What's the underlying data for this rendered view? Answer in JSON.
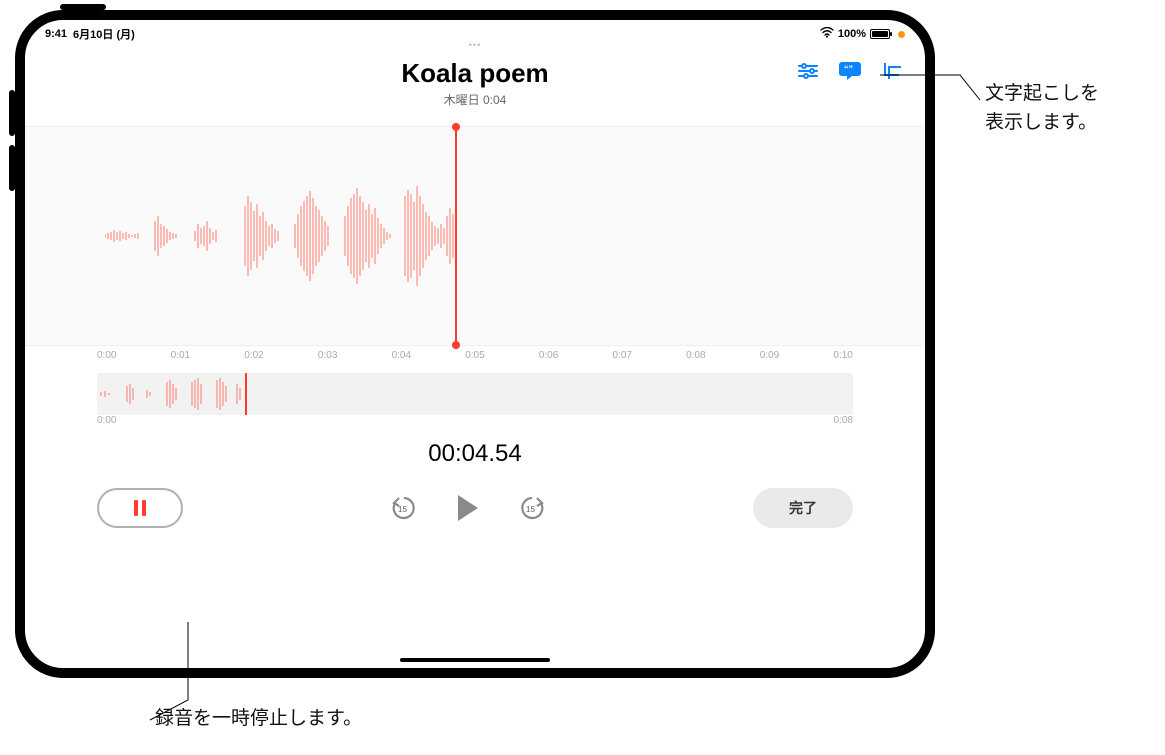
{
  "status": {
    "time": "9:41",
    "date": "6月10日 (月)",
    "wifi_icon": "wifi-icon",
    "battery_pct": "100%"
  },
  "toolbar": {
    "options_icon": "options-icon",
    "transcript_icon": "transcript-icon",
    "trim_icon": "trim-icon"
  },
  "recording": {
    "title": "Koala poem",
    "subtitle": "木曜日  0:04"
  },
  "ruler": {
    "ticks": [
      "0:00",
      "0:01",
      "0:02",
      "0:03",
      "0:04",
      "0:05",
      "0:06",
      "0:07",
      "0:08",
      "0:09",
      "0:10"
    ]
  },
  "overview": {
    "start": "0:00",
    "end": "0:08"
  },
  "timer": "00:04.54",
  "controls": {
    "pause_icon": "pause-icon",
    "back15_icon": "skip-back-15-icon",
    "play_icon": "play-icon",
    "fwd15_icon": "skip-forward-15-icon",
    "done_label": "完了"
  },
  "callouts": {
    "transcript": "文字起こしを\n表示します。",
    "pause": "録音を一時停止します。"
  }
}
